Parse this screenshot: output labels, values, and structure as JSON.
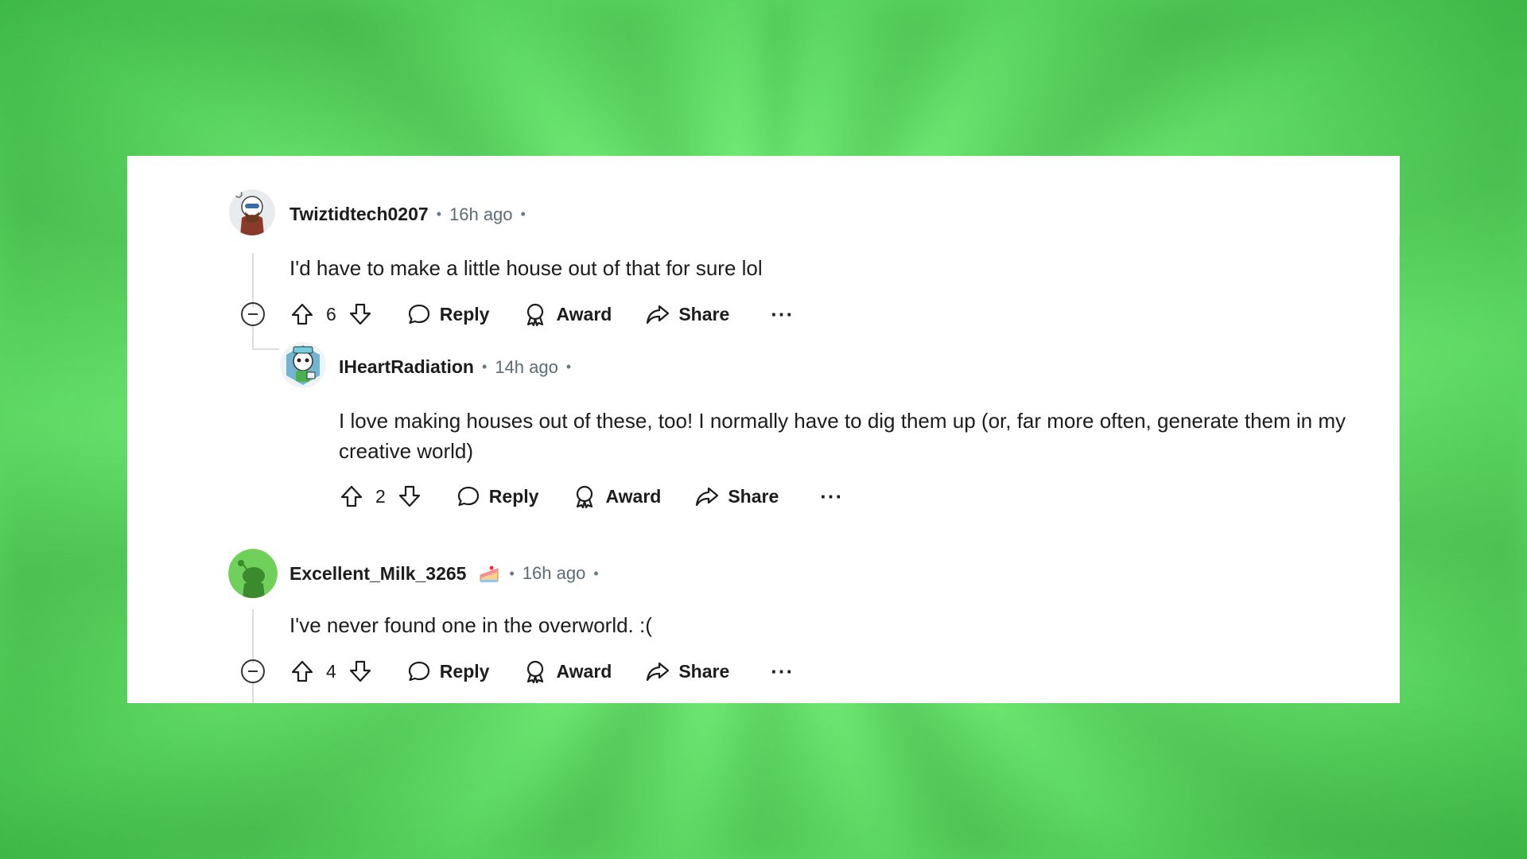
{
  "comments": [
    {
      "username": "Twiztidtech0207",
      "time": "16h ago",
      "body": "I'd have to make a little house out of that for sure lol",
      "votes": "6",
      "actions": {
        "reply": "Reply",
        "award": "Award",
        "share": "Share",
        "more": "···"
      }
    },
    {
      "username": "IHeartRadiation",
      "time": "14h ago",
      "body": "I love making houses out of these, too! I normally have to dig them up (or, far more often, generate them in my creative world)",
      "votes": "2",
      "actions": {
        "reply": "Reply",
        "award": "Award",
        "share": "Share",
        "more": "···"
      }
    },
    {
      "username": "Excellent_Milk_3265",
      "time": "16h ago",
      "body": "I've never found one in the overworld. :(",
      "votes": "4",
      "actions": {
        "reply": "Reply",
        "award": "Award",
        "share": "Share",
        "more": "···"
      }
    }
  ],
  "separator": "•",
  "colors": {
    "background": "#7af57d",
    "card": "#ffffff",
    "text": "#1c1c1c",
    "meta": "#5c6b75"
  }
}
